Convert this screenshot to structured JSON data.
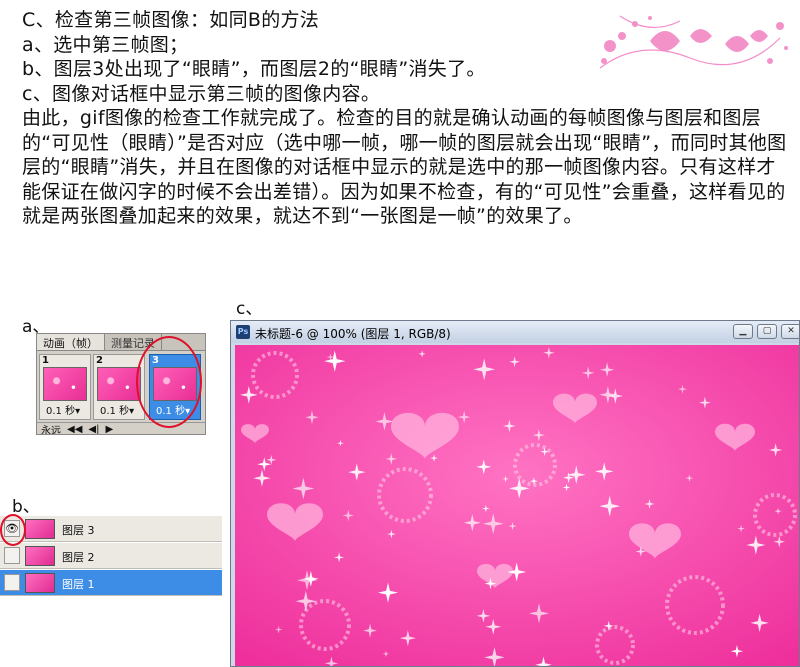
{
  "text": {
    "line1": "C、检查第三帧图像：如同B的方法",
    "line2": "a、选中第三帧图；",
    "line3": "b、图层3处出现了“眼睛”，而图层2的“眼睛”消失了。",
    "line4": "c、图像对话框中显示第三帧的图像内容。",
    "paragraph": "由此，gif图像的检查工作就完成了。检查的目的就是确认动画的每帧图像与图层和图层的“可见性（眼睛）”是否对应（选中哪一帧，哪一帧的图层就会出现“眼睛”，而同时其他图层的“眼睛”消失，并且在图像的对话框中显示的就是选中的那一帧图像内容。只有这样才能保证在做闪字的时候不会出差错）。因为如果不检查，有的“可见性”会重叠，这样看见的就是两张图叠加起来的效果，就达不到“一张图是一帧”的效果了。"
  },
  "labels": {
    "a": "a、",
    "b": "b、",
    "c": "c、"
  },
  "animation_panel": {
    "tabs": [
      "动画（帧）",
      "测量记录"
    ],
    "frames": [
      {
        "number": "1",
        "delay": "0.1 秒▾"
      },
      {
        "number": "2",
        "delay": "0.1 秒▾"
      },
      {
        "number": "3",
        "delay": "0.1 秒▾"
      }
    ],
    "loop": "永远",
    "selected_frame": 3
  },
  "layers_panel": {
    "layers": [
      {
        "name": "图层 3",
        "visible": true
      },
      {
        "name": "图层 2",
        "visible": false
      },
      {
        "name": "图层 1",
        "visible": false,
        "active": true
      }
    ]
  },
  "image_window": {
    "title": "未标题-6 @ 100% (图层 1, RGB/8)",
    "icon": "Ps"
  },
  "colors": {
    "canvas_pink": "#f545ab",
    "highlight_red": "#e0102a",
    "selection_blue": "#3d8ce6"
  }
}
